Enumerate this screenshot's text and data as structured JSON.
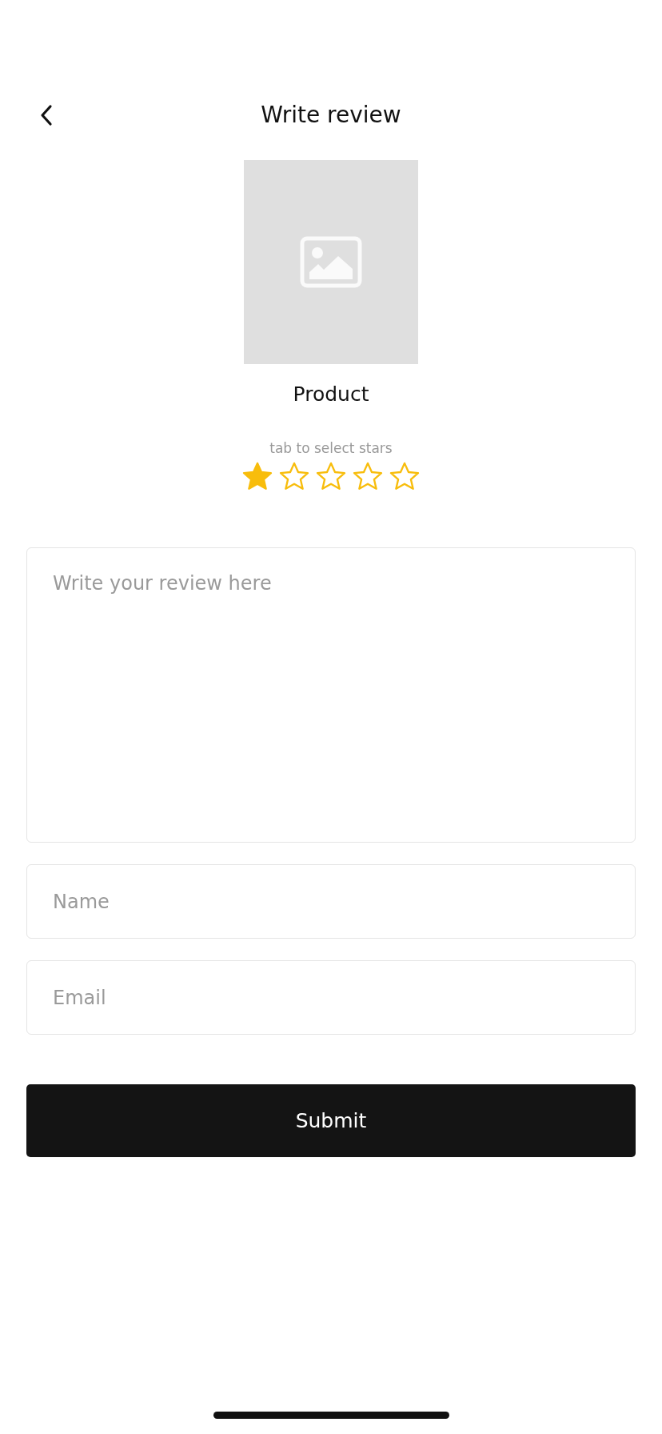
{
  "header": {
    "title": "Write review"
  },
  "product": {
    "name": "Product"
  },
  "rating": {
    "hint": "tab to select stars",
    "stars": 1
  },
  "form": {
    "fields": [
      {
        "kind": "textarea",
        "placeholder": "Write your review here"
      },
      {
        "kind": "input",
        "placeholder": "Name"
      },
      {
        "kind": "input",
        "placeholder": "Email"
      }
    ],
    "submit": "Submit"
  }
}
